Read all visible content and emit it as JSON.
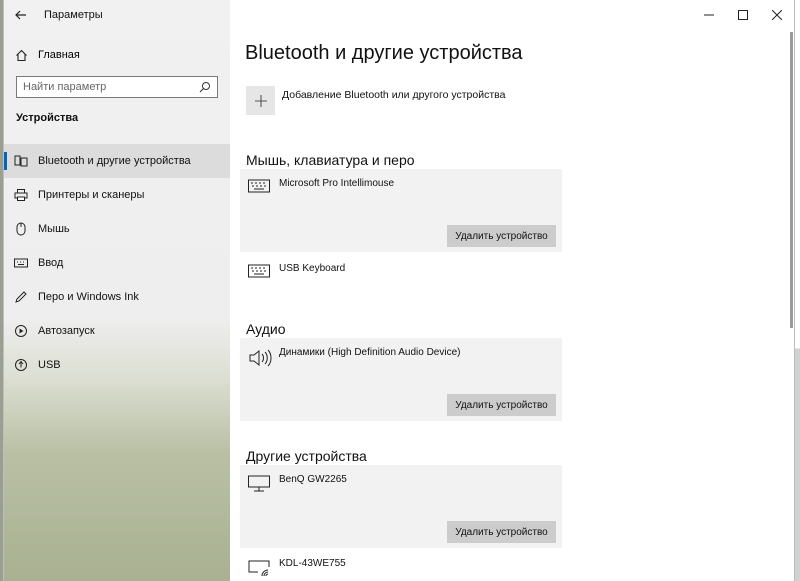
{
  "window": {
    "title": "Параметры"
  },
  "sidebar": {
    "home_label": "Главная",
    "search_placeholder": "Найти параметр",
    "section_title": "Устройства",
    "items": [
      {
        "label": "Bluetooth и другие устройства",
        "icon": "bluetooth-devices-icon",
        "active": true
      },
      {
        "label": "Принтеры и сканеры",
        "icon": "printer-icon",
        "active": false
      },
      {
        "label": "Мышь",
        "icon": "mouse-icon",
        "active": false
      },
      {
        "label": "Ввод",
        "icon": "keyboard-icon",
        "active": false
      },
      {
        "label": "Перо и Windows Ink",
        "icon": "pen-icon",
        "active": false
      },
      {
        "label": "Автозапуск",
        "icon": "autoplay-icon",
        "active": false
      },
      {
        "label": "USB",
        "icon": "usb-icon",
        "active": false
      }
    ]
  },
  "main": {
    "title": "Bluetooth и другие устройства",
    "add_label": "Добавление Bluetooth или другого устройства",
    "groups": [
      {
        "header": "Мышь, клавиатура и перо",
        "devices": [
          {
            "name": "Microsoft Pro Intellimouse",
            "icon": "keyboard-icon",
            "remove_label": "Удалить устройство"
          },
          {
            "name": "USB Keyboard",
            "icon": "keyboard-icon"
          }
        ]
      },
      {
        "header": "Аудио",
        "devices": [
          {
            "name": "Динамики (High Definition Audio Device)",
            "icon": "speaker-icon",
            "remove_label": "Удалить устройство"
          }
        ]
      },
      {
        "header": "Другие устройства",
        "devices": [
          {
            "name": "BenQ GW2265",
            "icon": "monitor-icon",
            "remove_label": "Удалить устройство"
          },
          {
            "name": "KDL-43WE755",
            "icon": "wireless-display-icon"
          }
        ]
      }
    ]
  },
  "colors": {
    "accent": "#0067c0",
    "card": "#f2f2f2",
    "button": "#cccccc"
  }
}
